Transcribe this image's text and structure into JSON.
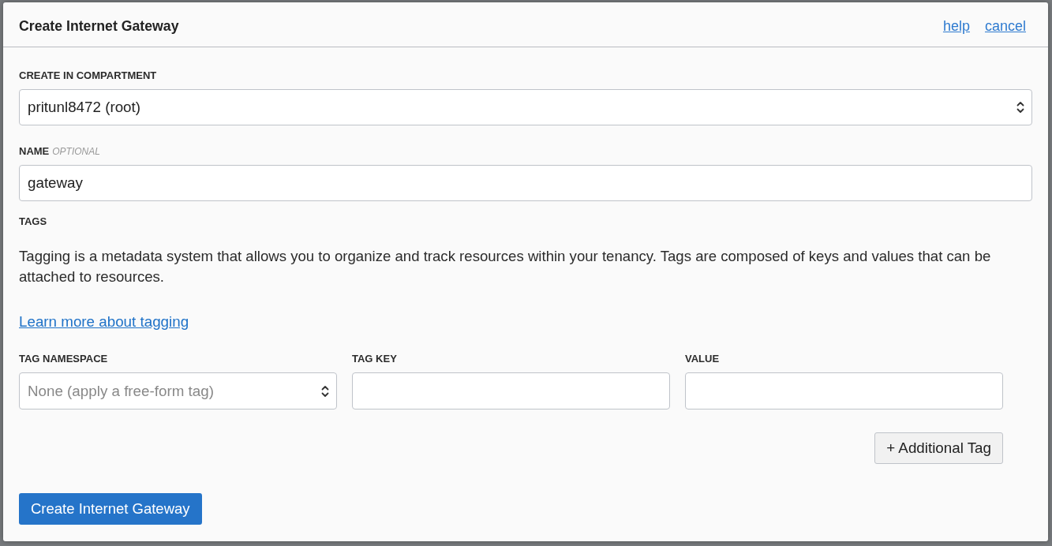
{
  "dialog": {
    "title": "Create Internet Gateway",
    "links": [
      "help",
      "cancel"
    ]
  },
  "fields": [
    {
      "kind": "select",
      "label": "CREATE IN COMPARTMENT",
      "value": "pritunl8472 (root)"
    },
    {
      "kind": "text",
      "label": "NAME",
      "qualifier": "OPTIONAL",
      "value": "gateway"
    }
  ],
  "tags": {
    "heading": "TAGS",
    "description": "Tagging is a metadata system that allows you to organize and track resources within your tenancy. Tags are composed of keys and values that can be attached to resources.",
    "link": "Learn more about tagging",
    "columns": [
      {
        "kind": "select",
        "label": "TAG NAMESPACE",
        "placeholder": "None (apply a free-form tag)"
      },
      {
        "kind": "text",
        "label": "TAG KEY"
      },
      {
        "kind": "text",
        "label": "VALUE"
      }
    ],
    "add_button": "+ Additional Tag"
  },
  "submit_button": "Create Internet Gateway"
}
